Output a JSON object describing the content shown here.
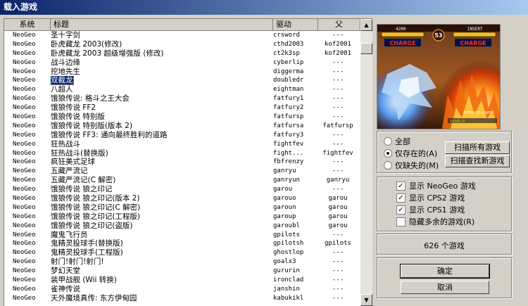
{
  "window": {
    "title": "载入游戏"
  },
  "columns": {
    "system": "系统",
    "title": "标题",
    "driver": "驱动",
    "parent": "父"
  },
  "games": [
    {
      "system": "NeoGeo",
      "title": "圣十字剑",
      "driver": "crsword",
      "parent": "---"
    },
    {
      "system": "NeoGeo",
      "title": "卧虎藏龙 2003(修改)",
      "driver": "cthd2003",
      "parent": "kof2001"
    },
    {
      "system": "NeoGeo",
      "title": "卧虎藏龙 2003 超级增强版 (修改)",
      "driver": "ct2k3sp",
      "parent": "kof2001"
    },
    {
      "system": "NeoGeo",
      "title": "战斗边缘",
      "driver": "cyberlip",
      "parent": "---"
    },
    {
      "system": "NeoGeo",
      "title": "挖地先生",
      "driver": "diggerma",
      "parent": "---"
    },
    {
      "system": "NeoGeo",
      "title": "双截龙",
      "driver": "doubledr",
      "parent": "---",
      "selected": true
    },
    {
      "system": "NeoGeo",
      "title": "八超人",
      "driver": "eightman",
      "parent": "---"
    },
    {
      "system": "NeoGeo",
      "title": "饿狼传说: 格斗之王大会",
      "driver": "fatfury1",
      "parent": "---"
    },
    {
      "system": "NeoGeo",
      "title": "饿狼传说 FF2",
      "driver": "fatfury2",
      "parent": "---"
    },
    {
      "system": "NeoGeo",
      "title": "饿狼传说 特别版",
      "driver": "fatfursp",
      "parent": "---"
    },
    {
      "system": "NeoGeo",
      "title": "饿狼传说 特别版(版本 2)",
      "driver": "fatfursa",
      "parent": "fatfursp"
    },
    {
      "system": "NeoGeo",
      "title": "饿狼传说 FF3: 通向最终胜利的道路",
      "driver": "fatfury3",
      "parent": "---"
    },
    {
      "system": "NeoGeo",
      "title": "狂热战斗",
      "driver": "fightfev",
      "parent": "---"
    },
    {
      "system": "NeoGeo",
      "title": "狂热战斗(替换版)",
      "driver": "fight...",
      "parent": "fightfev"
    },
    {
      "system": "NeoGeo",
      "title": "疯狂美式足球",
      "driver": "fbfrenzy",
      "parent": "---"
    },
    {
      "system": "NeoGeo",
      "title": "五藏严流记",
      "driver": "ganryu",
      "parent": "---"
    },
    {
      "system": "NeoGeo",
      "title": "五藏严流记(C 解密)",
      "driver": "ganryun",
      "parent": "ganryu"
    },
    {
      "system": "NeoGeo",
      "title": "饿狼传说 狼之印记",
      "driver": "garou",
      "parent": "---"
    },
    {
      "system": "NeoGeo",
      "title": "饿狼传说 狼之印记(版本 2)",
      "driver": "garouo",
      "parent": "garou"
    },
    {
      "system": "NeoGeo",
      "title": "饿狼传说 狼之印记(C 解密)",
      "driver": "garoun",
      "parent": "garou"
    },
    {
      "system": "NeoGeo",
      "title": "饿狼传说 狼之印记(工程版)",
      "driver": "garoup",
      "parent": "garou"
    },
    {
      "system": "NeoGeo",
      "title": "饿狼传说 狼之印记(盗版)",
      "driver": "garoubl",
      "parent": "garou"
    },
    {
      "system": "NeoGeo",
      "title": "魔鬼飞行员",
      "driver": "gpilots",
      "parent": "---"
    },
    {
      "system": "NeoGeo",
      "title": "鬼精灵投球手(替换版)",
      "driver": "gpilotsh",
      "parent": "gpilots"
    },
    {
      "system": "NeoGeo",
      "title": "鬼精灵投球手(工程版)",
      "driver": "ghostlop",
      "parent": "---"
    },
    {
      "system": "NeoGeo",
      "title": "射门!射门!射门!",
      "driver": "goalx3",
      "parent": "---"
    },
    {
      "system": "NeoGeo",
      "title": "梦幻天堂",
      "driver": "gururin",
      "parent": "---"
    },
    {
      "system": "NeoGeo",
      "title": "装甲战舰 (Wii 转换)",
      "driver": "ironclad",
      "parent": "---"
    },
    {
      "system": "NeoGeo",
      "title": "雀神传说",
      "driver": "janshin",
      "parent": "---"
    },
    {
      "system": "NeoGeo",
      "title": "天外魔境真传: 东方伊甸园",
      "driver": "kabukikl",
      "parent": "---"
    }
  ],
  "preview": {
    "hud_left": "4200",
    "hud_timer": "53",
    "hud_right": "INSERT",
    "charge_left": "CHARGE",
    "charge_right": "CHARGE",
    "watermark": "emucn.com",
    "power_label": "LEVEL 0"
  },
  "filter": {
    "all_label": "全部",
    "available_label": "仅存在的(A)",
    "missing_label": "仅缺失的(M)",
    "selected": "available"
  },
  "scan": {
    "scan_all_label": "扫描所有游戏",
    "scan_new_label": "扫描查找新游戏"
  },
  "options": [
    {
      "label": "显示 NeoGeo 游戏",
      "checked": true
    },
    {
      "label": "显示 CPS2 游戏",
      "checked": true
    },
    {
      "label": "显示 CPS1 游戏",
      "checked": true
    },
    {
      "label": "隐藏多余的游戏(R)",
      "checked": false
    }
  ],
  "status": {
    "count_text": "626 个游戏"
  },
  "actions": {
    "ok_label": "确定",
    "cancel_label": "取消"
  },
  "colors": {
    "titlebar": "#0a246a",
    "selection": "#0a246a",
    "charge": "#ff3010"
  }
}
